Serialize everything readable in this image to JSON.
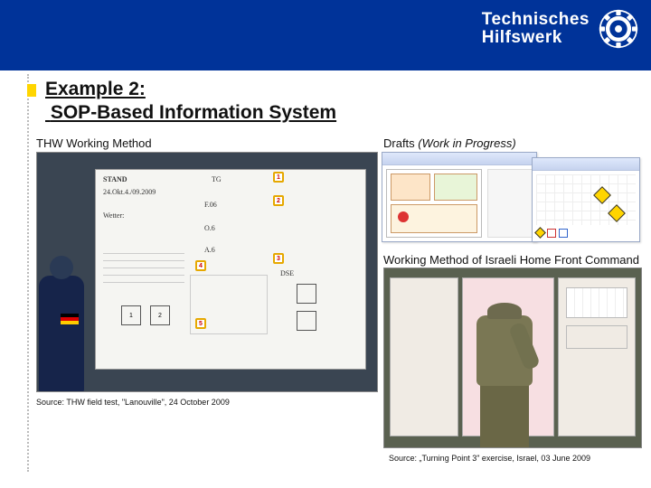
{
  "brand": {
    "line1": "Technisches",
    "line2": "Hilfswerk"
  },
  "title": {
    "line1": "Example 2:",
    "line2": "SOP-Based Information System"
  },
  "subtitles": {
    "thw": "THW Working Method",
    "drafts_label": "Drafts",
    "drafts_paren": "(Work in Progress)",
    "israel": "Working Method of Israeli Home Front Command"
  },
  "whiteboard": {
    "stand": "STAND",
    "date": "24.Okt.4./09.2009",
    "wetter": "Wetter:",
    "tg": "TG",
    "f06": "F.06",
    "o6": "O.6",
    "a6": "A.6",
    "dse": "DSE"
  },
  "captions": {
    "thw": "Source: THW field test, \"Lanouville\", 24 October 2009",
    "israel": "Source: „Turning Point 3\" exercise, Israel, 03 June 2009"
  }
}
